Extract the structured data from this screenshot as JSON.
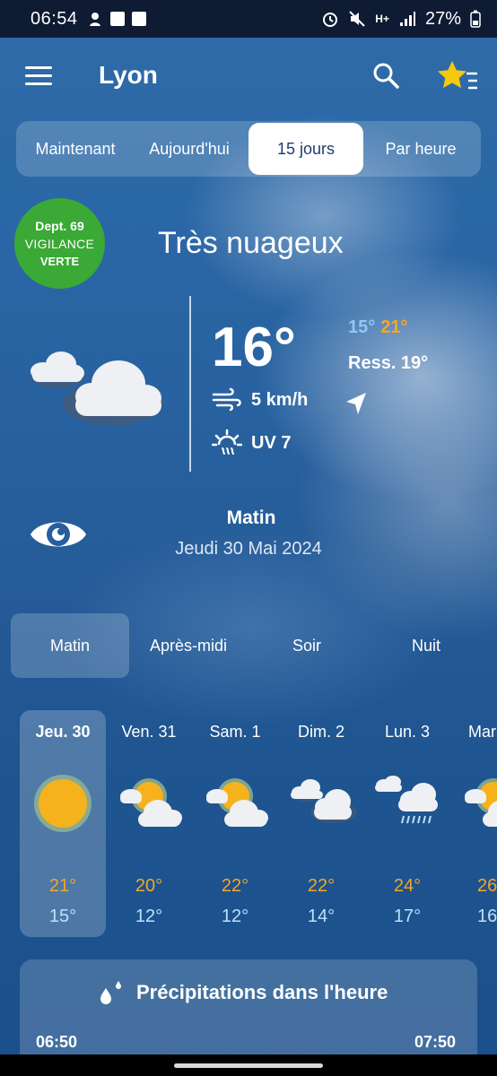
{
  "status": {
    "time": "06:54",
    "network": "H+",
    "battery": "27%"
  },
  "header": {
    "city": "Lyon",
    "icons": [
      "menu-icon",
      "search-icon",
      "favorites-star-icon"
    ]
  },
  "tabs": [
    "Maintenant",
    "Aujourd'hui",
    "15 jours",
    "Par heure"
  ],
  "active_tab": "15 jours",
  "vigilance": {
    "dept": "Dept. 69",
    "label": "VIGILANCE",
    "level": "VERTE",
    "color": "#3aa935"
  },
  "current": {
    "condition": "Très nuageux",
    "temp": "16°",
    "min": "15°",
    "max": "21°",
    "feels_like": "Ress. 19°",
    "wind": "5 km/h",
    "uv": "UV 7",
    "icon": "cloudy-icon"
  },
  "period": {
    "title": "Matin",
    "date": "Jeudi 30 Mai 2024"
  },
  "period_tabs": [
    "Matin",
    "Après-midi",
    "Soir",
    "Nuit"
  ],
  "active_period": "Matin",
  "days": [
    {
      "name": "Jeu. 30",
      "max": "21°",
      "min": "15°",
      "icon": "sun-icon"
    },
    {
      "name": "Ven. 31",
      "max": "20°",
      "min": "12°",
      "icon": "partly-cloudy-icon"
    },
    {
      "name": "Sam. 1",
      "max": "22°",
      "min": "12°",
      "icon": "partly-cloudy-icon"
    },
    {
      "name": "Dim. 2",
      "max": "22°",
      "min": "14°",
      "icon": "cloudy-icon"
    },
    {
      "name": "Lun. 3",
      "max": "24°",
      "min": "17°",
      "icon": "rain-icon"
    },
    {
      "name": "Mar",
      "max": "26",
      "min": "16",
      "icon": "partly-cloudy-icon"
    }
  ],
  "precipitation": {
    "title": "Précipitations dans l'heure",
    "start": "06:50",
    "end": "07:50"
  },
  "colors": {
    "max_temp": "#f5a623",
    "min_temp": "#8fc7f2",
    "sun": "#f6b21c"
  }
}
